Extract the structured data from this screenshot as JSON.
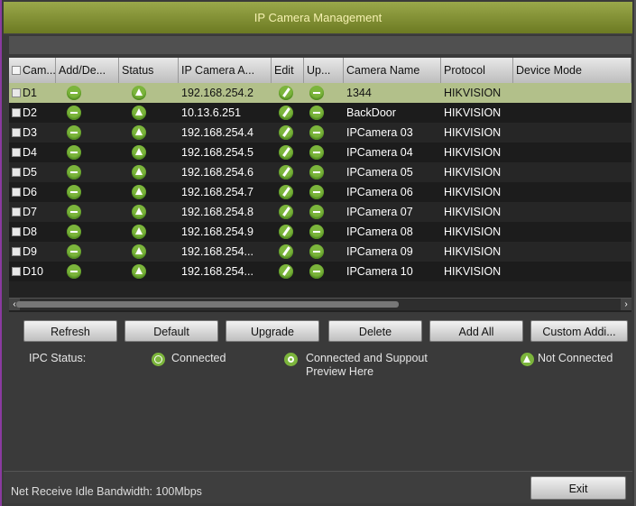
{
  "window": {
    "title": "IP Camera Management"
  },
  "table": {
    "headers": [
      "Cam...",
      "Add/De...",
      "Status",
      "IP Camera A...",
      "Edit",
      "Up...",
      "Camera Name",
      "Protocol",
      "Device Mode"
    ],
    "rows": [
      {
        "cam": "D1",
        "ip": "192.168.254.2",
        "name": "1344",
        "protocol": "HIKVISION",
        "selected": true
      },
      {
        "cam": "D2",
        "ip": "10.13.6.251",
        "name": "BackDoor",
        "protocol": "HIKVISION"
      },
      {
        "cam": "D3",
        "ip": "192.168.254.4",
        "name": "IPCamera 03",
        "protocol": "HIKVISION"
      },
      {
        "cam": "D4",
        "ip": "192.168.254.5",
        "name": "IPCamera 04",
        "protocol": "HIKVISION"
      },
      {
        "cam": "D5",
        "ip": "192.168.254.6",
        "name": "IPCamera 05",
        "protocol": "HIKVISION"
      },
      {
        "cam": "D6",
        "ip": "192.168.254.7",
        "name": "IPCamera 06",
        "protocol": "HIKVISION"
      },
      {
        "cam": "D7",
        "ip": "192.168.254.8",
        "name": "IPCamera 07",
        "protocol": "HIKVISION"
      },
      {
        "cam": "D8",
        "ip": "192.168.254.9",
        "name": "IPCamera 08",
        "protocol": "HIKVISION"
      },
      {
        "cam": "D9",
        "ip": "192.168.254...",
        "name": "IPCamera 09",
        "protocol": "HIKVISION"
      },
      {
        "cam": "D10",
        "ip": "192.168.254...",
        "name": "IPCamera 10",
        "protocol": "HIKVISION"
      }
    ]
  },
  "buttons": {
    "refresh": "Refresh",
    "default": "Default",
    "upgrade": "Upgrade",
    "delete": "Delete",
    "add_all": "Add All",
    "custom_add": "Custom Addi..."
  },
  "legend": {
    "label": "IPC Status:",
    "connected": "Connected",
    "connected_preview_line1": "Connected and Suppout",
    "connected_preview_line2": "Preview Here",
    "not_connected": "Not Connected"
  },
  "footer": {
    "bandwidth": "Net Receive Idle Bandwidth: 100Mbps",
    "exit": "Exit"
  },
  "colors": {
    "accent": "#7cb53c",
    "selected_row": "#b2c08a",
    "title_bar": "#8a9a3a"
  }
}
